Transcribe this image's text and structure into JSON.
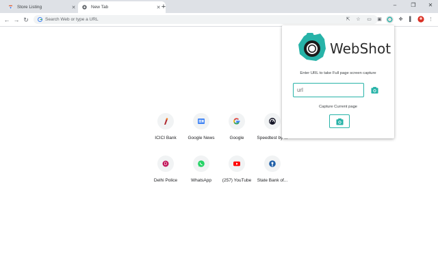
{
  "tabs": [
    {
      "title": "Store Listing",
      "active": false
    },
    {
      "title": "New Tab",
      "active": true
    }
  ],
  "toolbar": {
    "omnibox_placeholder": "Search Web or type a URL"
  },
  "shortcuts": [
    {
      "label": "ICICI Bank",
      "icon": "icici-icon"
    },
    {
      "label": "Google News",
      "icon": "google-news-icon"
    },
    {
      "label": "Google",
      "icon": "google-icon"
    },
    {
      "label": "Speedtest by ...",
      "icon": "speedtest-icon"
    },
    {
      "label": "Delhi Police",
      "icon": "delhi-police-icon"
    },
    {
      "label": "WhatsApp",
      "icon": "whatsapp-icon"
    },
    {
      "label": "(257) YouTube",
      "icon": "youtube-icon"
    },
    {
      "label": "State Bank of...",
      "icon": "sbi-icon"
    }
  ],
  "popup": {
    "brand": "WebShot",
    "instruction": "Enter URL to take Full page screen capture",
    "url_placeholder": "url",
    "capture_current_label": "Capture Current page"
  },
  "colors": {
    "accent": "#27b3a8",
    "tabstrip_bg": "#dee1e6",
    "omnibox_bg": "#f1f3f4"
  }
}
